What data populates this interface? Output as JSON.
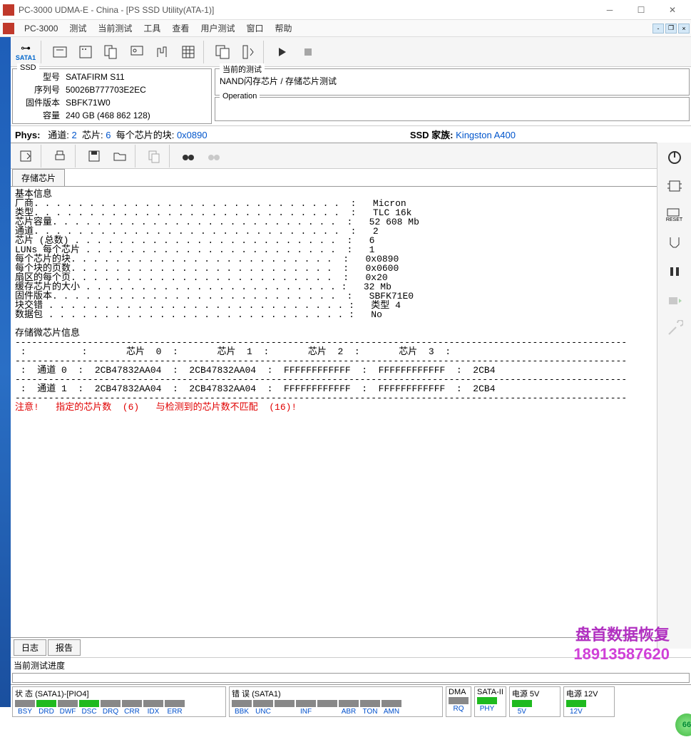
{
  "window": {
    "title": "PC-3000 UDMA-E - China - [PS SSD Utility(ATA-1)]"
  },
  "menu": {
    "app": "PC-3000",
    "items": [
      "测试",
      "当前测试",
      "工具",
      "查看",
      "用户测试",
      "窗口",
      "帮助"
    ]
  },
  "toolbar1": {
    "sata": "SATA1"
  },
  "ssd_panel": {
    "legend": "SSD",
    "model_label": "型号",
    "model": "SATAFIRM   S11",
    "serial_label": "序列号",
    "serial": "50026B777703E2EC",
    "fw_label": "固件版本",
    "fw": "SBFK71W0",
    "cap_label": "容量",
    "cap": "240 GB (468 862 128)"
  },
  "current_test": {
    "legend": "当前的测试",
    "text": "NAND闪存芯片 / 存储芯片测试"
  },
  "operation": {
    "legend": "Operation"
  },
  "phys": {
    "label": "Phys:",
    "ch_label": "通道:",
    "ch": "2",
    "chip_label": "芯片:",
    "chip": "6",
    "blocks_label": "每个芯片的块:",
    "blocks": "0x0890",
    "family_label": "SSD 家族:",
    "family": "Kingston A400"
  },
  "tab": {
    "label": "存储芯片"
  },
  "info_lines": {
    "header": "基本信息",
    "rows": [
      [
        "厂商",
        "Micron"
      ],
      [
        "类型",
        "TLC 16k"
      ],
      [
        "芯片容量",
        "52 608 Mb"
      ],
      [
        "通道",
        "2"
      ],
      [
        "芯片 (总数)",
        "6"
      ],
      [
        "LUNs 每个芯片",
        "1"
      ],
      [
        "每个芯片的块",
        "0x0890"
      ],
      [
        "每个块的页数",
        "0x0600"
      ],
      [
        "扇区的每个页",
        "0x20"
      ],
      [
        "缓存芯片的大小",
        "32 Mb"
      ],
      [
        "固件版本",
        "SBFK71E0"
      ],
      [
        "块交错",
        "类型 4"
      ],
      [
        "数据包",
        "No"
      ]
    ],
    "dump_header": "存储微芯片信息",
    "chip_cols": [
      "芯片 0",
      "芯片 1",
      "芯片 2",
      "芯片 3"
    ],
    "rows2": [
      [
        "通道 0",
        "2CB47832AA04",
        "2CB47832AA04",
        "FFFFFFFFFFFF",
        "FFFFFFFFFFFF",
        "2CB4"
      ],
      [
        "通道 1",
        "2CB47832AA04",
        "2CB47832AA04",
        "FFFFFFFFFFFF",
        "FFFFFFFFFFFF",
        "2CB4"
      ]
    ],
    "warning": "注意!   指定的芯片数  (6)   与检测到的芯片数不匹配  (16)!"
  },
  "bottom_tabs": {
    "log": "日志",
    "report": "报告"
  },
  "progress": {
    "label": "当前测试进度"
  },
  "status": {
    "state_legend": "状 态 (SATA1)-[PIO4]",
    "state_items": [
      "BSY",
      "DRD",
      "DWF",
      "DSC",
      "DRQ",
      "CRR",
      "IDX",
      "ERR"
    ],
    "state_on": [
      0,
      1,
      0,
      1,
      0,
      0,
      0,
      0
    ],
    "error_legend": "错 误 (SATA1)",
    "error_items": [
      "BBK",
      "UNC",
      "",
      "INF",
      "",
      "ABR",
      "TON",
      "AMN"
    ],
    "dma_legend": "DMA",
    "dma_items": [
      "RQ"
    ],
    "sata2_legend": "SATA-II",
    "sata2_items": [
      "PHY"
    ],
    "sata2_on": [
      1
    ],
    "pwr5_legend": "电源 5V",
    "pwr5_items": [
      "5V"
    ],
    "pwr5_on": [
      1
    ],
    "pwr12_legend": "电源 12V",
    "pwr12_items": [
      "12V"
    ],
    "pwr12_on": [
      1
    ]
  },
  "watermark": {
    "l1": "盘首数据恢复",
    "l2": "18913587620"
  },
  "badge": "66",
  "reset_label": "RESET"
}
